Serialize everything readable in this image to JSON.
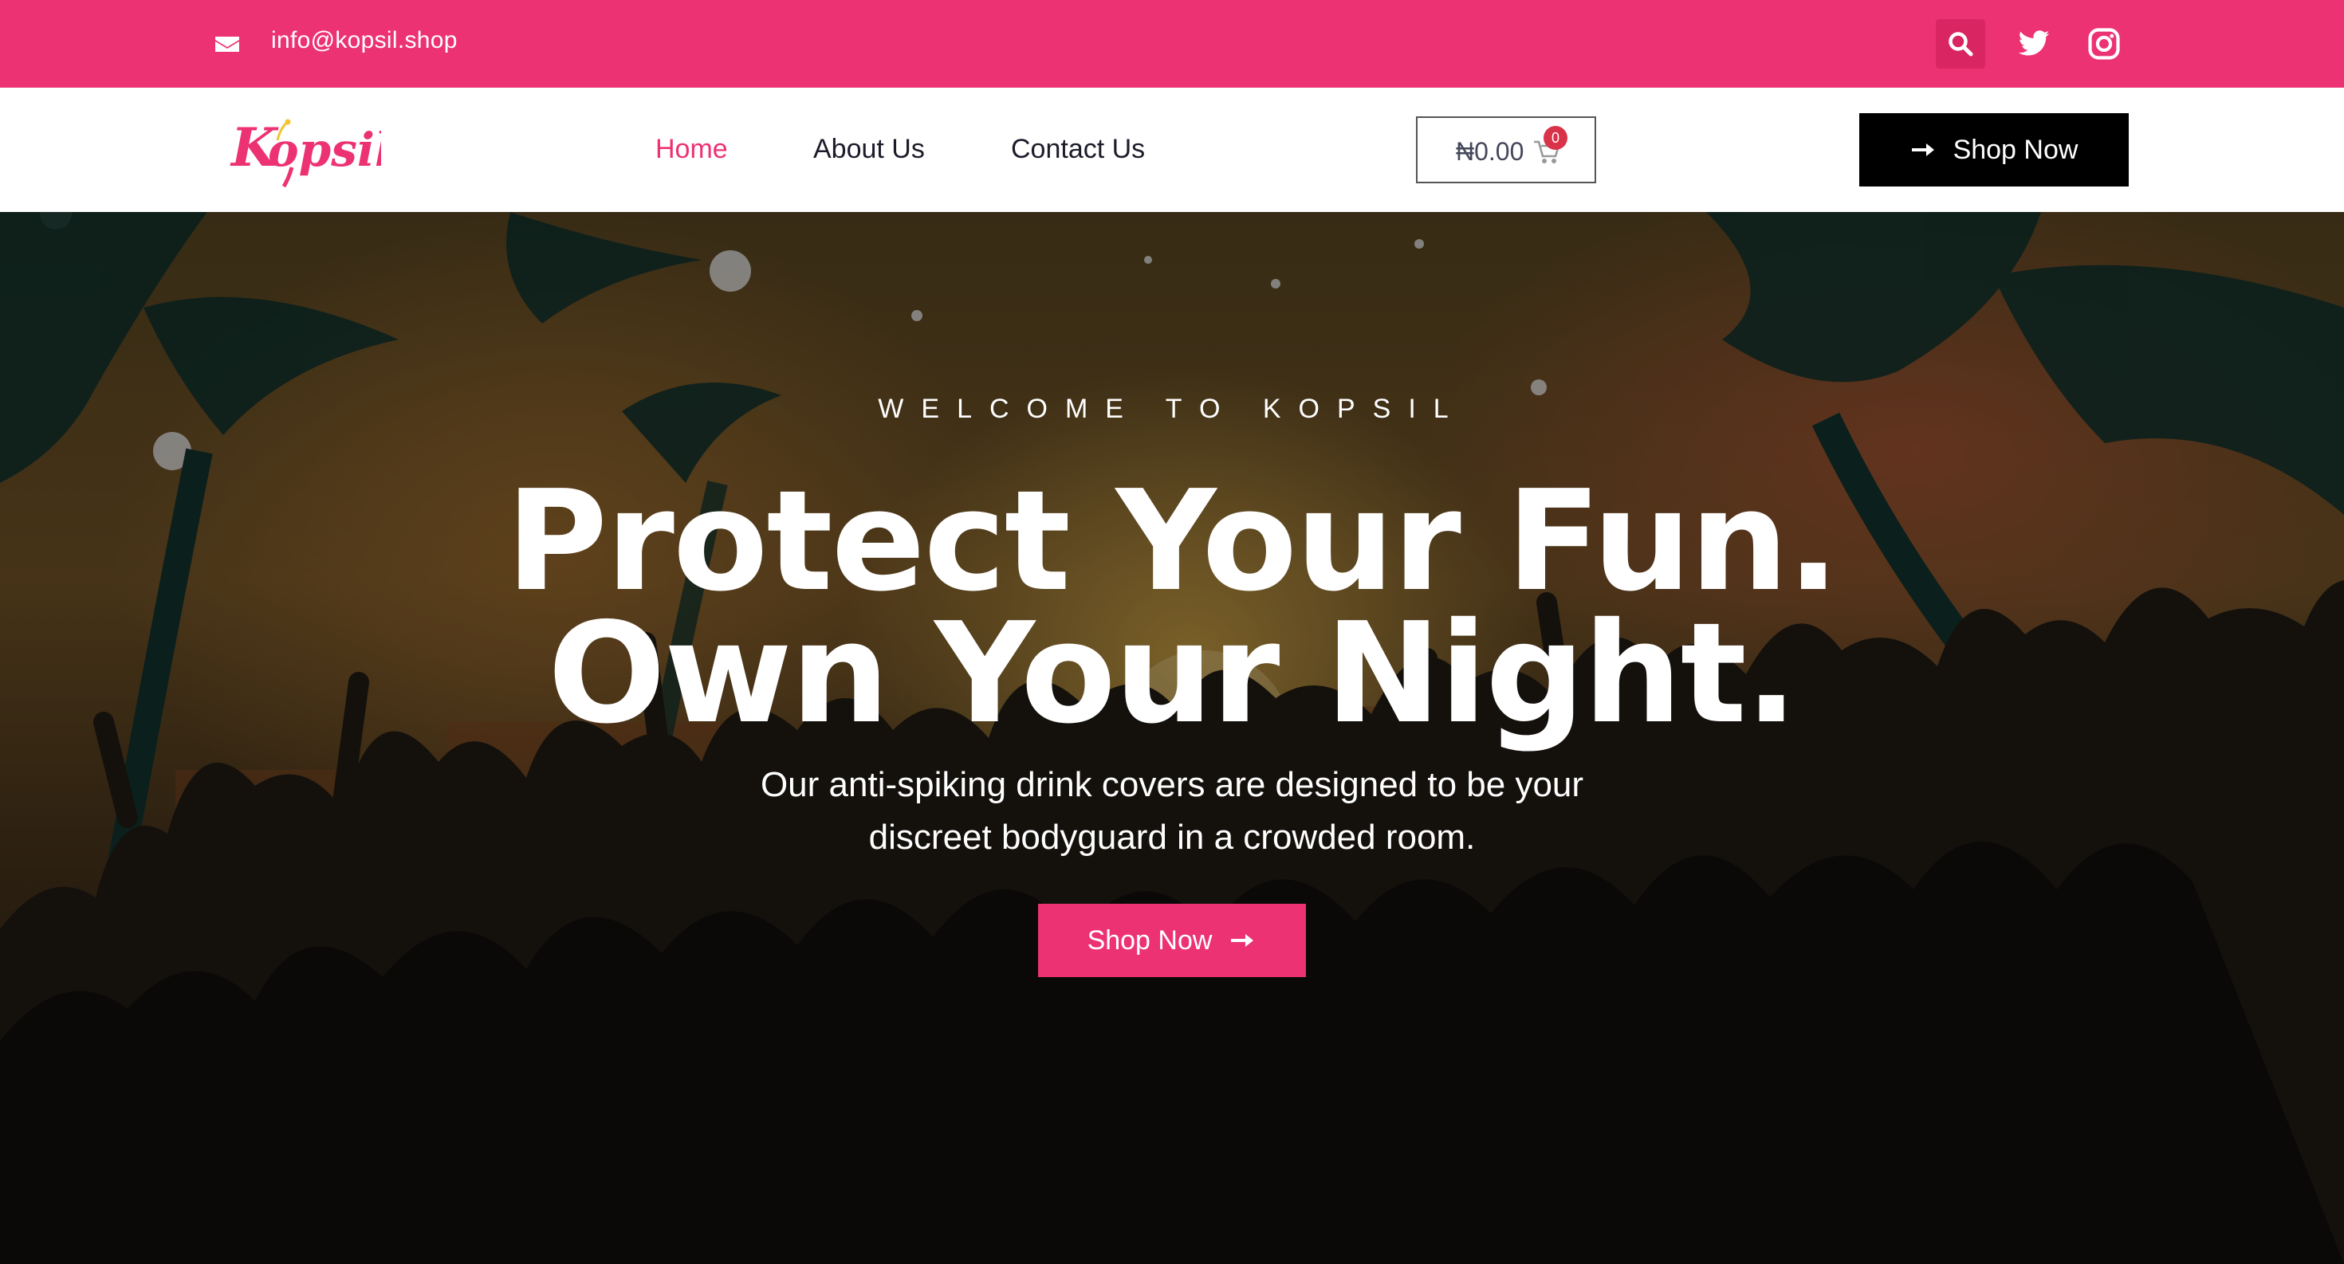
{
  "topbar": {
    "email": "info@kopsil.shop",
    "icons": [
      "envelope-icon",
      "search-icon",
      "twitter-icon",
      "instagram-icon"
    ]
  },
  "navbar": {
    "logo_text": "Kopsil",
    "links": [
      {
        "label": "Home",
        "active": true
      },
      {
        "label": "About Us",
        "active": false
      },
      {
        "label": "Contact Us",
        "active": false
      }
    ],
    "cart": {
      "amount": "₦0.00",
      "count": "0"
    },
    "cta_label": "Shop Now"
  },
  "hero": {
    "eyebrow": "WELCOME TO KOPSIL",
    "headline_line1": "Protect Your Fun.",
    "headline_line2": "Own Your Night.",
    "subtitle_line1": "Our anti-spiking drink covers are designed to be your",
    "subtitle_line2": "discreet bodyguard in a crowded room.",
    "cta_label": "Shop Now"
  },
  "colors": {
    "brand_pink": "#ec3273",
    "nav_text": "#1c1c2a",
    "cta_dark": "#000000"
  }
}
